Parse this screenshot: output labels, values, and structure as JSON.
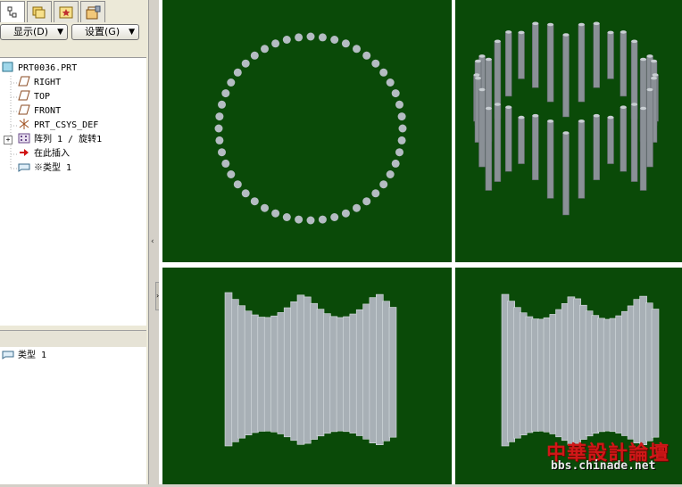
{
  "toolbar": {
    "display_label": "显示(D)",
    "settings_label": "设置(G)"
  },
  "tabs": [
    {
      "icon": "model-tree-icon"
    },
    {
      "icon": "folder-browser-icon"
    },
    {
      "icon": "favorites-icon"
    },
    {
      "icon": "connections-icon"
    }
  ],
  "model_tree": {
    "items": [
      {
        "label": "PRT0036.PRT",
        "icon": "part-icon"
      },
      {
        "label": "RIGHT",
        "icon": "datum-plane-icon"
      },
      {
        "label": "TOP",
        "icon": "datum-plane-icon"
      },
      {
        "label": "FRONT",
        "icon": "datum-plane-icon"
      },
      {
        "label": "PRT_CSYS_DEF",
        "icon": "csys-icon"
      },
      {
        "label": "阵列 1 / 旋转1",
        "icon": "pattern-icon"
      },
      {
        "label": "在此插入",
        "icon": "insert-here-arrow-icon"
      },
      {
        "label": "※类型 1",
        "icon": "type-icon"
      }
    ]
  },
  "layer_list": {
    "items": [
      {
        "label": "类型 1",
        "icon": "type-icon"
      }
    ]
  },
  "watermark": {
    "title": "中華設計論壇",
    "url": "bbs.chinade.net"
  },
  "colors": {
    "viewport_bg": "#0a4a08",
    "feature_gray": "#b4bcc2"
  }
}
